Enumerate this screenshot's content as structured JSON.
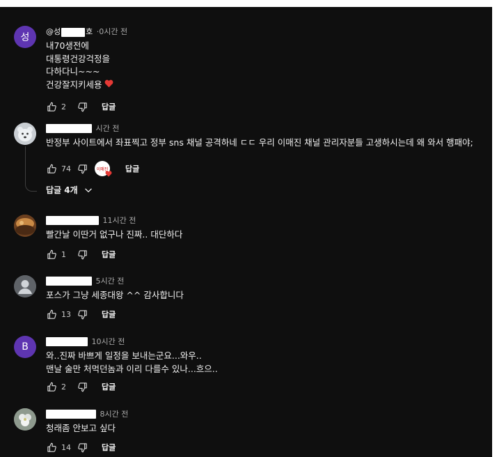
{
  "colors": {
    "background": "#0f0f0f",
    "text": "#f1f1f1",
    "muted": "#aaaaaa",
    "heart": "#e53935"
  },
  "comments": [
    {
      "avatar_letter": "성",
      "avatar_color": "#5e35b1",
      "author_visible": "@성",
      "author_suffix": "호",
      "time": "·0시간 전",
      "text": "내70생전에\n대통령건강걱정을\n다하다니~~~\n건강잘지키세용",
      "like_count": "2",
      "reply_label": "답글",
      "icons": [
        "thumb-up-icon",
        "thumb-down-icon",
        "heart-icon"
      ]
    },
    {
      "avatar_color": "#c9ced3",
      "time": "시간 전",
      "text": "반정부 사이트에서 좌표찍고 정부 sns  채널 공격하네 ㄷㄷ 우리 이매진 채널 관리자분들 고생하시는데 왜 와서 행패야;",
      "like_count": "74",
      "reply_label": "답글",
      "creator_heart_label": "이매진",
      "replies_toggle": "답글 4개",
      "icons": [
        "thumb-up-icon",
        "thumb-down-icon",
        "heart-icon",
        "chevron-down-icon"
      ]
    },
    {
      "avatar_color": "#8a5a2b",
      "time": "11시간 전",
      "text": "빨간날 이딴거 없구나 진짜.. 대단하다",
      "like_count": "1",
      "reply_label": "답글",
      "icons": [
        "thumb-up-icon",
        "thumb-down-icon"
      ]
    },
    {
      "avatar_color": "#5f6368",
      "time": "5시간 전",
      "text": "포스가 그냥 세종대왕 ^^ 감사합니다",
      "like_count": "13",
      "reply_label": "답글",
      "icons": [
        "thumb-up-icon",
        "thumb-down-icon",
        "person-icon"
      ]
    },
    {
      "avatar_letter": "B",
      "avatar_color": "#5e35b1",
      "time": "10시간 전",
      "text": "와..진짜 바쁘게 일정을 보내는군요...와우..\n맨날 술만 처먹던놈과 이리 다를수 있나...흐으..",
      "like_count": "2",
      "reply_label": "답글",
      "icons": [
        "thumb-up-icon",
        "thumb-down-icon"
      ]
    },
    {
      "avatar_color": "#9aa59a",
      "time": "8시간 전",
      "text": "청래좀 안보고 싶다",
      "like_count": "14",
      "reply_label": "답글",
      "icons": [
        "thumb-up-icon",
        "thumb-down-icon"
      ]
    }
  ]
}
